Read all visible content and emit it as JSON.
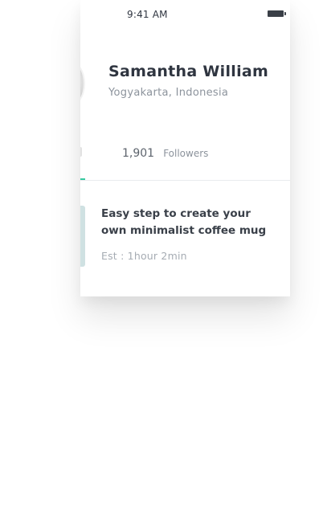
{
  "status_bar": {
    "time": "9:41 AM",
    "battery_icon": "battery-icon"
  },
  "profile": {
    "name": "Samantha William",
    "location": "Yogyakarta, Indonesia",
    "avatar_icon": "avatar"
  },
  "stats": {
    "followers_value": "1,901",
    "followers_label": "Followers"
  },
  "colors": {
    "accent": "#37c9a0",
    "text_dark": "#2f3540",
    "text_muted": "#8c939c",
    "thumb": "#cfe1e2"
  },
  "post": {
    "title": "Easy step to create your own minimalist coffee mug",
    "estimate": "Est : 1hour 2min"
  }
}
